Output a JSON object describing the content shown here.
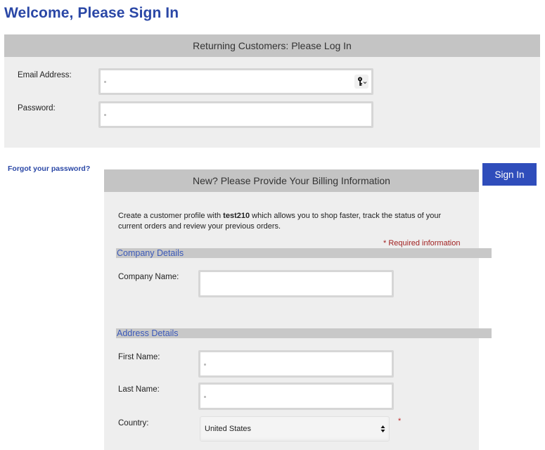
{
  "page": {
    "title": "Welcome, Please Sign In"
  },
  "login": {
    "header": "Returning Customers: Please Log In",
    "email_label": "Email Address:",
    "email_value": "",
    "password_label": "Password:",
    "password_value": "",
    "forgot_link": "Forgot your password?",
    "signin_button": "Sign In"
  },
  "billing": {
    "header": "New? Please Provide Your Billing Information",
    "intro_prefix": "Create a customer profile with ",
    "store_name": "test210",
    "intro_suffix": " which allows you to shop faster, track the status of your current orders and review your previous orders.",
    "required_note": "* Required information",
    "company_section": "Company Details",
    "company_name_label": "Company Name:",
    "company_name_value": "",
    "address_section": "Address Details",
    "first_name_label": "First Name:",
    "first_name_value": "",
    "last_name_label": "Last Name:",
    "last_name_value": "",
    "country_label": "Country:",
    "country_value": "United States",
    "country_required_mark": "*"
  },
  "colors": {
    "title_blue": "#2a47a6",
    "button_blue": "#2f4dbb",
    "panel_bg": "#eeeeee",
    "header_bg": "#c4c4c4",
    "required_red": "#a01f1f"
  },
  "icons": {
    "password_manager": "key-icon",
    "select_arrows": "updown-arrows-icon"
  }
}
